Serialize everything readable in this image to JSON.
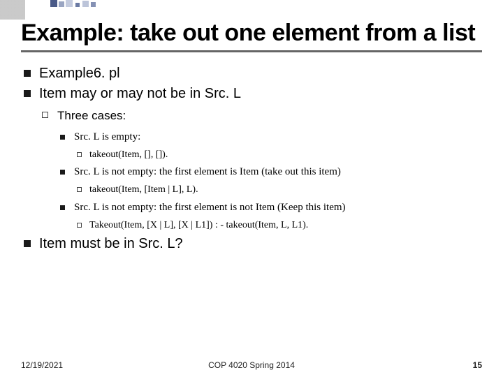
{
  "title": "Example: take out one element from a list",
  "bullets": {
    "b1": "Example6. pl",
    "b2": "Item may or may not be in Src. L",
    "b2_1": "Three cases:",
    "b2_1_1": "Src. L is empty:",
    "b2_1_1_a": "takeout(Item, [], []).",
    "b2_1_2": "Src. L is not empty: the first element is Item (take out this item)",
    "b2_1_2_a": "takeout(Item, [Item | L], L).",
    "b2_1_3": "Src. L is not empty: the first element is not Item (Keep this item)",
    "b2_1_3_a": "Takeout(Item, [X | L], [X | L1]) : - takeout(Item, L, L1).",
    "b3": "Item must be in Src. L?"
  },
  "footer": {
    "date": "12/19/2021",
    "center": "COP 4020 Spring 2014",
    "page": "15"
  }
}
